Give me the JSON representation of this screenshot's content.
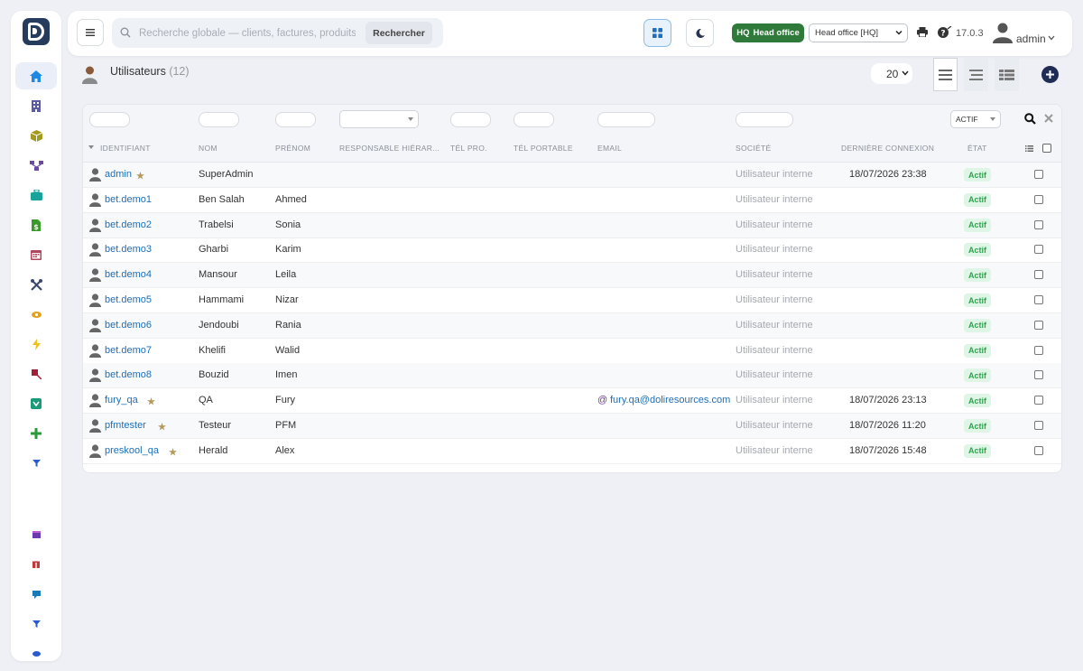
{
  "app": {
    "search_placeholder": "Recherche globale — clients, factures, produits...",
    "search_button": "Rechercher",
    "hq_short": "HQ",
    "hq_label": "Head office",
    "entity_selected": "Head office [HQ]",
    "version": "17.0.3",
    "user": "admin"
  },
  "sidebar": {
    "items": [
      {
        "icon": "home-icon",
        "color": "#1e88e5",
        "active": true
      },
      {
        "icon": "building-icon",
        "color": "#5a5aa8"
      },
      {
        "icon": "cube-icon",
        "color": "#a39a1f"
      },
      {
        "icon": "hierarchy-icon",
        "color": "#6b4aa3"
      },
      {
        "icon": "briefcase-icon",
        "color": "#1aa39a"
      },
      {
        "icon": "invoice-dollar-icon",
        "color": "#3a9a2a"
      },
      {
        "icon": "calendar-icon",
        "color": "#b0445a"
      },
      {
        "icon": "tools-icon",
        "color": "#3a4a6a"
      },
      {
        "icon": "eye-icon",
        "color": "#e0a020"
      },
      {
        "icon": "bolt-icon",
        "color": "#f0c020"
      },
      {
        "icon": "pin-icon",
        "color": "#a0203a"
      },
      {
        "icon": "shield-icon",
        "color": "#1a9a7a"
      },
      {
        "icon": "plus-icon",
        "color": "#2a9a3a"
      },
      {
        "icon": "filter-icon",
        "color": "#2a5ad0"
      },
      {
        "icon": "screen-icon",
        "color": "#6a3ab0"
      },
      {
        "icon": "gift-icon",
        "color": "#c03a3a"
      },
      {
        "icon": "chat-icon",
        "color": "#1a7ab8"
      },
      {
        "icon": "filter-icon",
        "color": "#2a5ad0"
      },
      {
        "icon": "disk-icon",
        "color": "#2a5ad0"
      }
    ]
  },
  "page": {
    "title": "Utilisateurs",
    "count": "(12)",
    "limit": "20"
  },
  "filters": {
    "status_selected": "ACTIF"
  },
  "columns": {
    "login": "IDENTIFIANT",
    "lastname": "NOM",
    "firstname": "PRÉNOM",
    "supervisor": "RESPONSABLE HIÉRAR...",
    "phone_pro": "TÉL PRO.",
    "phone_mobile": "TÉL PORTABLE",
    "email": "EMAIL",
    "company": "SOCIÉTÉ",
    "last_login": "DERNIÈRE CONNEXION",
    "status": "ÉTAT"
  },
  "rows": [
    {
      "login": "admin",
      "admin": true,
      "lastname": "SuperAdmin",
      "firstname": "",
      "email": "",
      "company": "Utilisateur interne",
      "last_login": "18/07/2026 23:38",
      "status": "Actif"
    },
    {
      "login": "bet.demo1",
      "admin": false,
      "lastname": "Ben Salah",
      "firstname": "Ahmed",
      "email": "",
      "company": "Utilisateur interne",
      "last_login": "",
      "status": "Actif"
    },
    {
      "login": "bet.demo2",
      "admin": false,
      "lastname": "Trabelsi",
      "firstname": "Sonia",
      "email": "",
      "company": "Utilisateur interne",
      "last_login": "",
      "status": "Actif"
    },
    {
      "login": "bet.demo3",
      "admin": false,
      "lastname": "Gharbi",
      "firstname": "Karim",
      "email": "",
      "company": "Utilisateur interne",
      "last_login": "",
      "status": "Actif"
    },
    {
      "login": "bet.demo4",
      "admin": false,
      "lastname": "Mansour",
      "firstname": "Leila",
      "email": "",
      "company": "Utilisateur interne",
      "last_login": "",
      "status": "Actif"
    },
    {
      "login": "bet.demo5",
      "admin": false,
      "lastname": "Hammami",
      "firstname": "Nizar",
      "email": "",
      "company": "Utilisateur interne",
      "last_login": "",
      "status": "Actif"
    },
    {
      "login": "bet.demo6",
      "admin": false,
      "lastname": "Jendoubi",
      "firstname": "Rania",
      "email": "",
      "company": "Utilisateur interne",
      "last_login": "",
      "status": "Actif"
    },
    {
      "login": "bet.demo7",
      "admin": false,
      "lastname": "Khelifi",
      "firstname": "Walid",
      "email": "",
      "company": "Utilisateur interne",
      "last_login": "",
      "status": "Actif"
    },
    {
      "login": "bet.demo8",
      "admin": false,
      "lastname": "Bouzid",
      "firstname": "Imen",
      "email": "",
      "company": "Utilisateur interne",
      "last_login": "",
      "status": "Actif"
    },
    {
      "login": "fury_qa",
      "admin": true,
      "lastname": "QA",
      "firstname": "Fury",
      "email": "fury.qa@doliresources.com",
      "company": "Utilisateur interne",
      "last_login": "18/07/2026 23:13",
      "status": "Actif"
    },
    {
      "login": "pfmtester",
      "admin": true,
      "lastname": "Testeur",
      "firstname": "PFM",
      "email": "",
      "company": "Utilisateur interne",
      "last_login": "18/07/2026 11:20",
      "status": "Actif"
    },
    {
      "login": "preskool_qa",
      "admin": true,
      "lastname": "Herald",
      "firstname": "Alex",
      "email": "",
      "company": "Utilisateur interne",
      "last_login": "18/07/2026 15:48",
      "status": "Actif"
    }
  ]
}
